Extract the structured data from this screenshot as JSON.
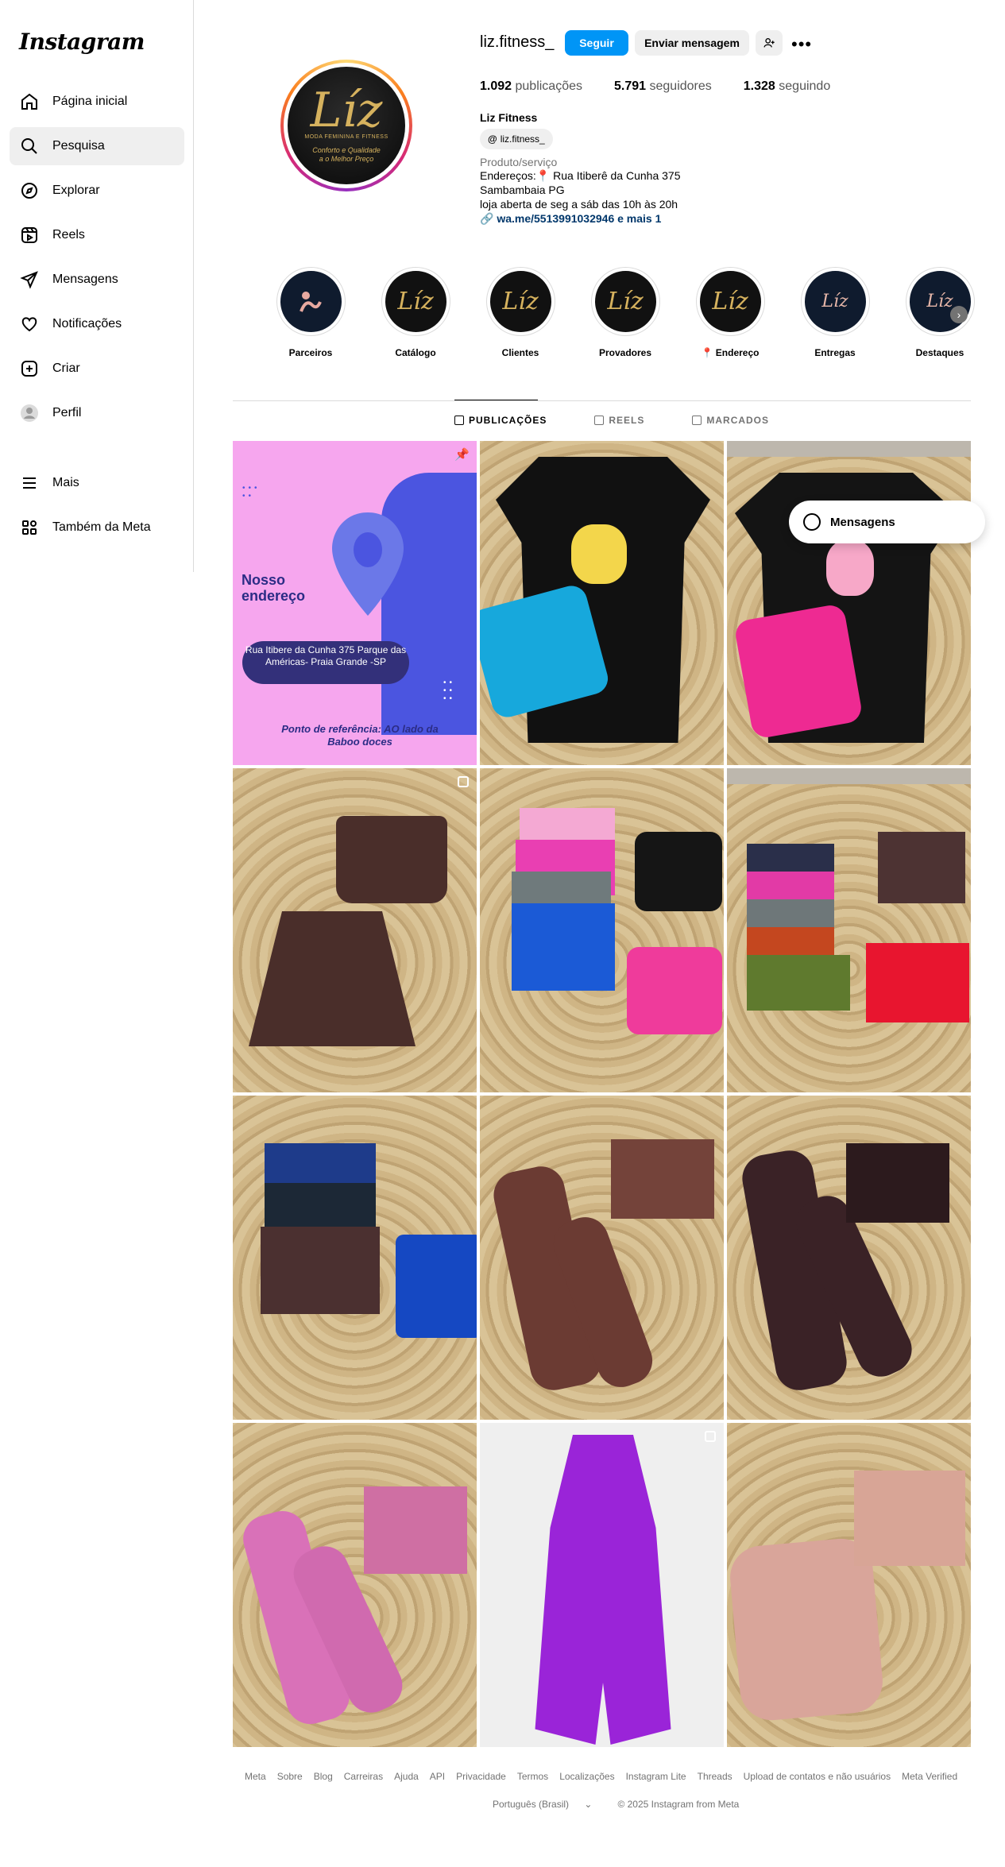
{
  "app": {
    "logo": "Instagram"
  },
  "sidebar": {
    "items": [
      {
        "label": "Página inicial",
        "icon": "home-icon"
      },
      {
        "label": "Pesquisa",
        "icon": "search-icon"
      },
      {
        "label": "Explorar",
        "icon": "compass-icon"
      },
      {
        "label": "Reels",
        "icon": "reels-icon"
      },
      {
        "label": "Mensagens",
        "icon": "paper-plane-icon"
      },
      {
        "label": "Notificações",
        "icon": "heart-icon"
      },
      {
        "label": "Criar",
        "icon": "plus-square-icon"
      },
      {
        "label": "Perfil",
        "icon": "avatar-icon"
      }
    ],
    "more": {
      "label": "Mais",
      "icon": "menu-icon"
    },
    "meta": {
      "label": "Também da Meta",
      "icon": "grid-icon"
    }
  },
  "profile": {
    "username": "liz.fitness_",
    "follow_label": "Seguir",
    "message_label": "Enviar mensagem",
    "stats": {
      "posts_count": "1.092",
      "posts_label": "publicações",
      "followers_count": "5.791",
      "followers_label": "seguidores",
      "following_count": "1.328",
      "following_label": "seguindo"
    },
    "full_name": "Liz Fitness",
    "threads_handle": "liz.fitness_",
    "category": "Produto/serviço",
    "bio_line1": "Endereços:📍 Rua Itiberê da Cunha 375",
    "bio_line2": "Sambambaia PG",
    "bio_line3": "loja aberta de seg a sáb das 10h às 20h",
    "link": "wa.me/5513991032946 e mais 1",
    "avatar": {
      "big": "Líz",
      "small": "MODA FEMININA E FITNESS",
      "tagline": "Conforto e Qualidade a o Melhor Preço"
    }
  },
  "highlights": [
    {
      "label": "Parceiros"
    },
    {
      "label": "Catálogo"
    },
    {
      "label": "Clientes"
    },
    {
      "label": "Provadores"
    },
    {
      "label": "📍 Endereço"
    },
    {
      "label": "Entregas"
    },
    {
      "label": "Destaques"
    }
  ],
  "tabs": [
    {
      "label": "PUBLICAÇÕES"
    },
    {
      "label": "REELS"
    },
    {
      "label": "MARCADOS"
    }
  ],
  "post1": {
    "title_line1": "Nosso",
    "title_line2": "endereço",
    "address": "Rua Itibere da Cunha 375 Parque das Américas- Praia Grande -SP",
    "reference": "Ponto de referência: AO lado da Baboo doces"
  },
  "messages_popup": {
    "label": "Mensagens"
  },
  "footer": {
    "links": [
      "Meta",
      "Sobre",
      "Blog",
      "Carreiras",
      "Ajuda",
      "API",
      "Privacidade",
      "Termos",
      "Localizações",
      "Instagram Lite",
      "Threads",
      "Upload de contatos e não usuários",
      "Meta Verified"
    ],
    "language": "Português (Brasil)",
    "copyright": "© 2025 Instagram from Meta"
  },
  "colors": {
    "accent": "#0095f6",
    "link": "#00376b",
    "muted": "#737373"
  }
}
